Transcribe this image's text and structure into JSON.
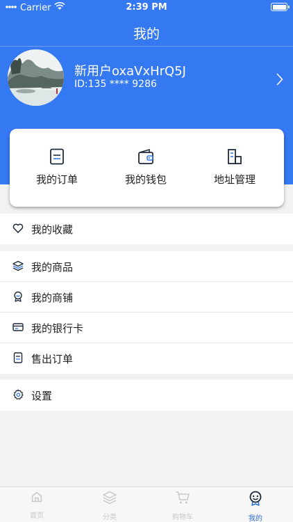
{
  "status_bar": {
    "carrier": "Carrier",
    "time": "2:39 PM"
  },
  "nav": {
    "title": "我的"
  },
  "profile": {
    "username": "新用户oxaVxHrQ5J",
    "user_id": "ID:135 **** 9286"
  },
  "quick_actions": [
    {
      "label": "我的订单",
      "icon": "order-icon"
    },
    {
      "label": "我的钱包",
      "icon": "wallet-icon"
    },
    {
      "label": "地址管理",
      "icon": "address-icon"
    }
  ],
  "menu": {
    "favorites": "我的收藏",
    "products": "我的商品",
    "shop": "我的商铺",
    "bank_card": "我的银行卡",
    "sold_orders": "售出订单",
    "settings": "设置"
  },
  "tabs": [
    {
      "label": "首页",
      "icon": "home-icon"
    },
    {
      "label": "分类",
      "icon": "category-icon"
    },
    {
      "label": "购物车",
      "icon": "cart-icon"
    },
    {
      "label": "我的",
      "icon": "profile-icon"
    }
  ],
  "colors": {
    "brand": "#3478f2",
    "active_tab": "#2f6fd6",
    "inactive_tab": "#c8c8c8"
  }
}
